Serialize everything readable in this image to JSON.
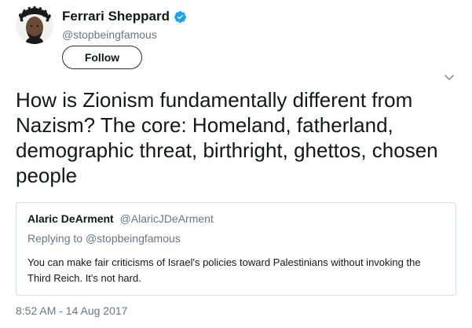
{
  "author": {
    "display_name": "Ferrari Sheppard",
    "handle": "@stopbeingfamous",
    "verified": true,
    "avatar_icon": "profile-photo"
  },
  "follow_button": {
    "label": "Follow"
  },
  "menu": {
    "icon": "chevron-down-icon"
  },
  "tweet": {
    "text": "How is Zionism fundamentally different from Nazism? The core: Homeland, fatherland, demographic threat, birthright, ghettos, chosen people",
    "timestamp": "8:52 AM - 14 Aug 2017"
  },
  "quoted_tweet": {
    "display_name": "Alaric DeArment",
    "handle": "@AlaricJDeArment",
    "replying_prefix": "Replying to ",
    "replying_to": "@stopbeingfamous",
    "text": "You can make fair criticisms of Israel's policies toward Palestinians without invoking the Third Reich. It's not hard."
  },
  "colors": {
    "verified_badge": "#1da1f2",
    "secondary_text": "#657786",
    "primary_text": "#14171a",
    "card_border": "#d8dee2"
  }
}
